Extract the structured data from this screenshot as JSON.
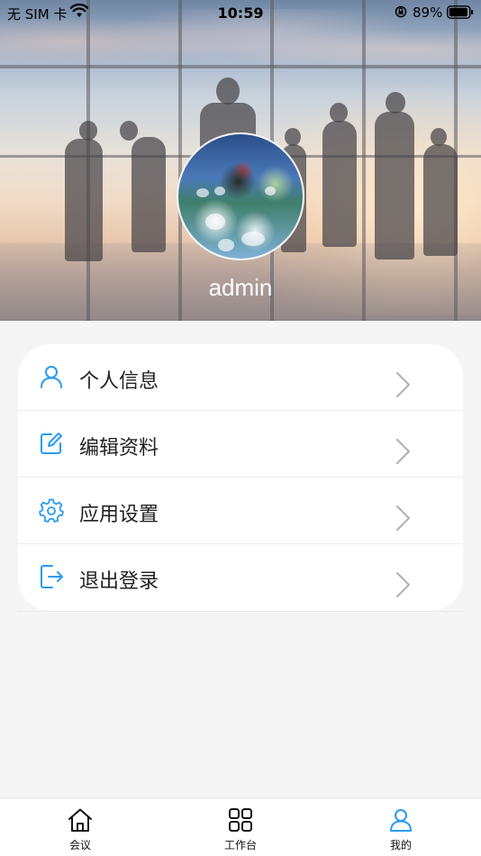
{
  "status_bar": {
    "carrier": "无 SIM 卡",
    "time": "10:59",
    "battery_percent": "89%"
  },
  "profile": {
    "username": "admin"
  },
  "menu": {
    "items": [
      {
        "label": "个人信息",
        "icon": "user-icon"
      },
      {
        "label": "编辑资料",
        "icon": "edit-icon"
      },
      {
        "label": "应用设置",
        "icon": "gear-icon"
      },
      {
        "label": "退出登录",
        "icon": "logout-icon"
      }
    ]
  },
  "tab_bar": {
    "tabs": [
      {
        "label": "会议",
        "icon": "home-icon"
      },
      {
        "label": "工作台",
        "icon": "grid-icon"
      },
      {
        "label": "我的",
        "icon": "user-icon",
        "active": true
      }
    ]
  },
  "colors": {
    "accent": "#2a9bf0",
    "page_bg": "#f5f5f5",
    "card_bg": "#ffffff",
    "chevron": "#b0b0b0"
  }
}
